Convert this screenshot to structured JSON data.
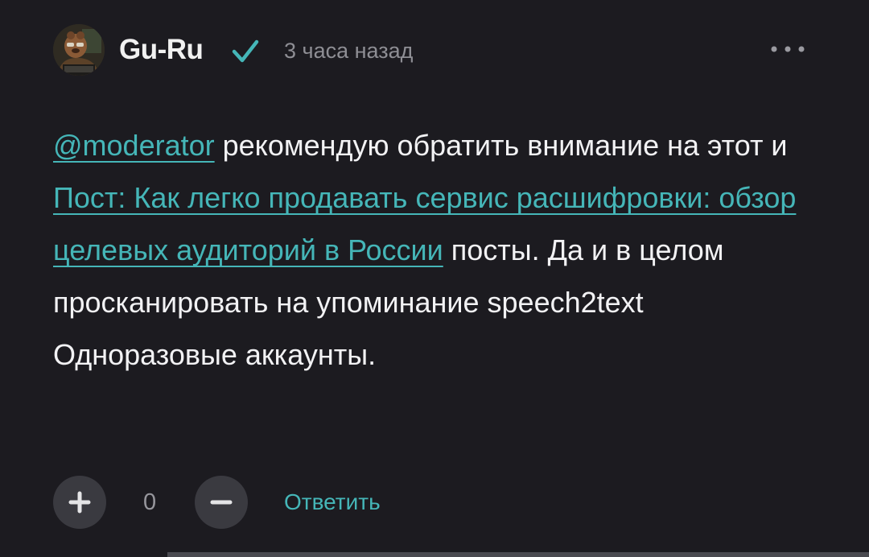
{
  "comment": {
    "author": {
      "name": "Gu-Ru",
      "verified_icon": "checkmark-icon",
      "avatar_icon": "avatar-image"
    },
    "time": "3 часа назад",
    "more_icon": "ellipsis-icon",
    "body": {
      "mention": "@moderator",
      "text_1": " рекомендую обратить внимание на этот и ",
      "post_link": "Пост: Как легко продавать сервис расшифровки: обзор целевых аудиторий в России",
      "text_2": " посты. Да и в целом просканировать на упоминание speech2text Одноразовые аккаунты."
    },
    "actions": {
      "upvote_icon": "plus-icon",
      "score": "0",
      "downvote_icon": "minus-icon",
      "reply_label": "Ответить"
    }
  },
  "colors": {
    "background": "#1c1b20",
    "link": "#45b6b8",
    "text": "#f2f2f4",
    "muted": "#8e8e94",
    "button_bg": "#3a3a40"
  }
}
